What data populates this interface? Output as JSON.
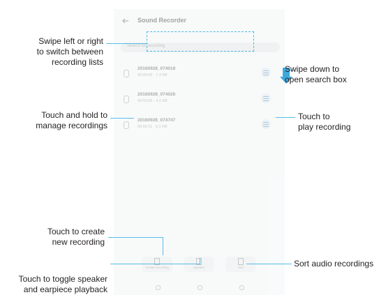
{
  "phone": {
    "app_title": "Sound Recorder",
    "search_placeholder": "Search for recording",
    "recordings": [
      {
        "name": "20160928_074018",
        "meta": "00:00:09 · 7.3 KB"
      },
      {
        "name": "20160928_074026",
        "meta": "00:00:05 · 4.2 KB"
      },
      {
        "name": "20160928_074747",
        "meta": "00:00:11 · 9.1 KB"
      }
    ],
    "bottom_buttons": [
      "Create recording",
      "Speaker",
      "Sort"
    ]
  },
  "annotations": {
    "swipe_lists": "Swipe left or right\nto switch between\nrecording lists",
    "swipe_down": "Swipe down to\nopen search box",
    "touch_hold": "Touch and hold to\nmanage recordings",
    "touch_play": "Touch to\nplay recording",
    "create_new": "Touch to create\nnew recording",
    "toggle_speaker": "Touch to toggle speaker\nand earpiece playback",
    "sort_audio": "Sort audio recordings"
  },
  "colors": {
    "accent": "#3fa8dd",
    "line": "#55bde8",
    "text": "#231f20"
  }
}
